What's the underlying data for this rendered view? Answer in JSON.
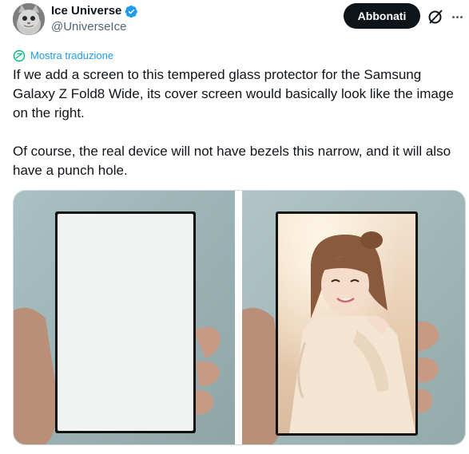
{
  "author": {
    "display_name": "Ice Universe",
    "handle": "@UniverseIce",
    "avatar_icon": "cat-avatar",
    "verified_icon": "verified-badge-icon",
    "verified_color": "#1d9bf0"
  },
  "actions": {
    "follow_label": "Abbonati",
    "grok_icon": "grok-icon",
    "more_icon": "more-icon"
  },
  "translate": {
    "label": "Mostra traduzione",
    "icon": "translate-icon"
  },
  "tweet": {
    "paragraphs": [
      "If we add a screen to this tempered glass protector for the Samsung Galaxy Z Fold8 Wide, its cover screen would basically look like the image on the right.",
      "Of course, the real device will not have bezels this narrow, and it will also have a punch hole."
    ]
  },
  "media": {
    "panels": [
      "blank tempered glass protector held in hand",
      "protector with photo of a smiling woman displayed"
    ]
  },
  "colors": {
    "text": "#0f1419",
    "secondary": "#536471",
    "link": "#1d9bf0",
    "button_bg": "#0f1419",
    "button_text": "#ffffff"
  }
}
